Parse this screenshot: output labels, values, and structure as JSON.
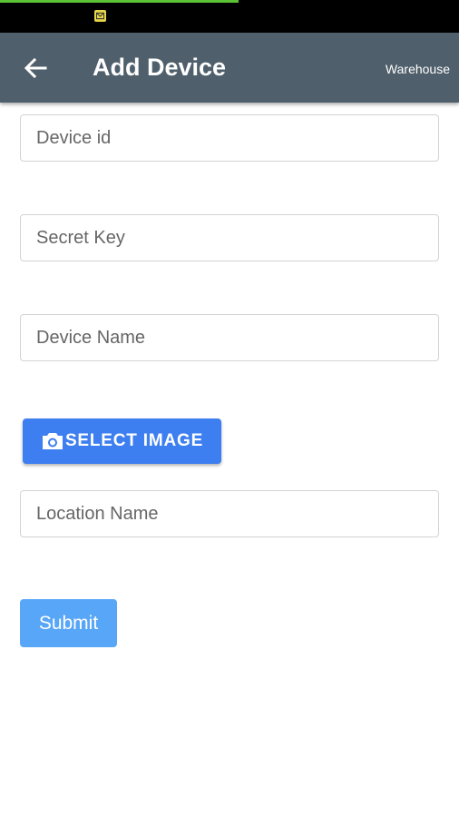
{
  "status_bar": {
    "notification_icon": "mail-notification-icon",
    "progress": 0.52
  },
  "app_bar": {
    "back_icon": "arrow-left-icon",
    "title": "Add Device",
    "action_label": "Warehouse",
    "background": "#4f5f6b"
  },
  "form": {
    "device_id": {
      "placeholder": "Device id",
      "value": ""
    },
    "secret_key": {
      "placeholder": "Secret Key",
      "value": ""
    },
    "device_name": {
      "placeholder": "Device Name",
      "value": ""
    },
    "select_image": {
      "label": "SELECT IMAGE",
      "icon": "camera-icon",
      "color": "#3d7ef0"
    },
    "location_name": {
      "placeholder": "Location Name",
      "value": ""
    },
    "submit": {
      "label": "Submit",
      "color": "#58a6f8"
    }
  }
}
